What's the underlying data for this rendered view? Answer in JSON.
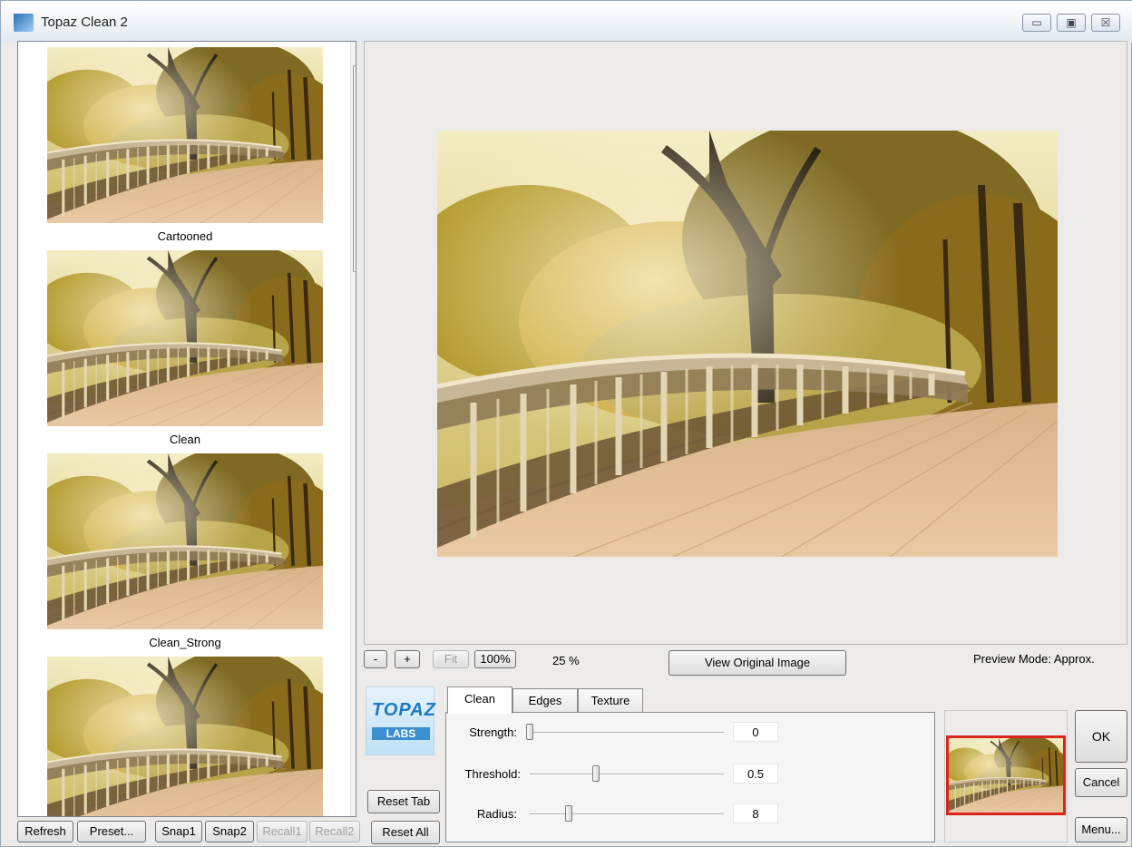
{
  "window": {
    "title": "Topaz Clean 2",
    "controls": {
      "minimize": "▭",
      "maximize": "▣",
      "close": "☒"
    }
  },
  "presets": [
    {
      "label": "Cartooned"
    },
    {
      "label": "Clean"
    },
    {
      "label": "Clean_Strong"
    },
    {
      "label": ""
    }
  ],
  "scrollbar": {
    "up": "▲",
    "down": "▼"
  },
  "bottom_left_buttons": {
    "refresh": "Refresh",
    "preset": "Preset...",
    "snap1": "Snap1",
    "snap2": "Snap2",
    "recall1": "Recall1",
    "recall2": "Recall2"
  },
  "zoom": {
    "minus": "-",
    "plus": "+",
    "fit": "Fit",
    "hundred": "100%",
    "level": "25 %",
    "view_original": "View Original Image",
    "preview_mode": "Preview Mode:  Approx."
  },
  "logo": {
    "text": "TOPAZ",
    "sub": "LABS"
  },
  "reset": {
    "tab": "Reset Tab",
    "all": "Reset All"
  },
  "tabs": [
    {
      "label": "Clean",
      "active": true
    },
    {
      "label": "Edges",
      "active": false
    },
    {
      "label": "Texture",
      "active": false
    }
  ],
  "sliders": [
    {
      "label": "Strength:",
      "value": "0",
      "fraction": 0.0
    },
    {
      "label": "Threshold:",
      "value": "0.5",
      "fraction": 0.34
    },
    {
      "label": "Radius:",
      "value": "8",
      "fraction": 0.2
    }
  ],
  "actions": {
    "ok": "OK",
    "cancel": "Cancel",
    "menu": "Menu..."
  },
  "colors": {
    "nav_frame": "#d9261c",
    "window_bg": "#ecebe9"
  }
}
